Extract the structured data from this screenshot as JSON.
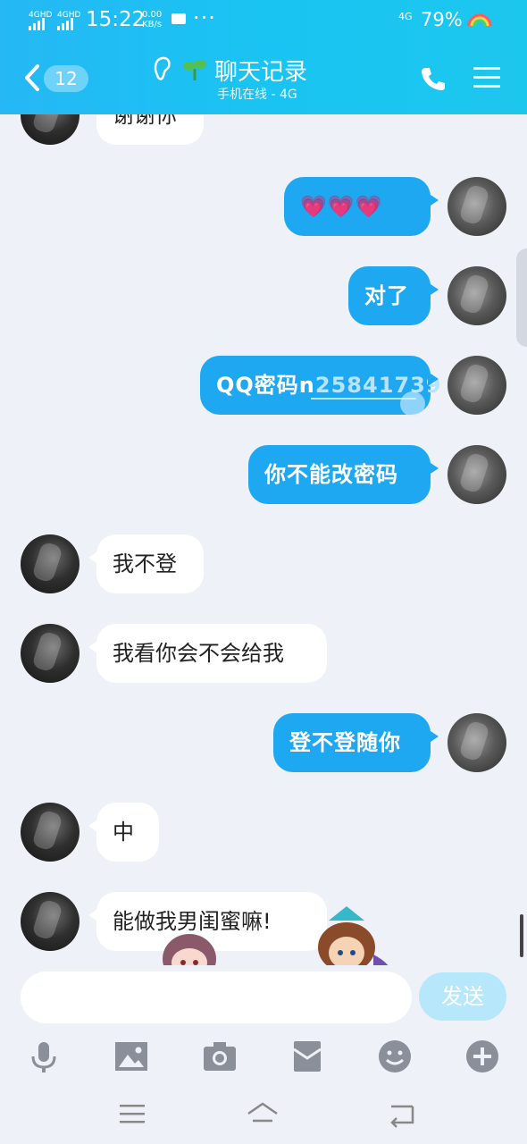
{
  "status_bar": {
    "sig1": "4GHD",
    "sig2": "4GHD",
    "time": "15:22",
    "speed_value": "0.00",
    "speed_unit": "KB/s",
    "network": "4G",
    "battery": "79%"
  },
  "header": {
    "back_count": "12",
    "title": "聊天记录",
    "subtitle": "手机在线 - 4G"
  },
  "messages": [
    {
      "side": "in",
      "text": "谢谢你"
    },
    {
      "side": "out",
      "text": "💗💗💗"
    },
    {
      "side": "out",
      "text": "对了"
    },
    {
      "side": "out",
      "text_prefix": "QQ密码n",
      "text_link": "25841739"
    },
    {
      "side": "out",
      "text": "你不能改密码"
    },
    {
      "side": "in",
      "text": "我不登"
    },
    {
      "side": "in",
      "text": "我看你会不会给我"
    },
    {
      "side": "out",
      "text": "登不登随你"
    },
    {
      "side": "in",
      "text": "中"
    },
    {
      "side": "in",
      "text": "能做我男闺蜜嘛!"
    }
  ],
  "input": {
    "placeholder": "",
    "send_label": "发送"
  },
  "toolbar": {
    "icons": [
      "microphone-icon",
      "image-icon",
      "camera-icon",
      "red-packet-icon",
      "emoji-icon",
      "plus-icon"
    ]
  },
  "nav": {
    "icons": [
      "menu-icon",
      "home-icon",
      "back-icon"
    ]
  },
  "colors": {
    "header": "#1fbff2",
    "outgoing_bubble": "#1fa8f2",
    "incoming_bubble": "#ffffff",
    "background": "#eef1f7",
    "send_button": "#b7e7fb"
  }
}
